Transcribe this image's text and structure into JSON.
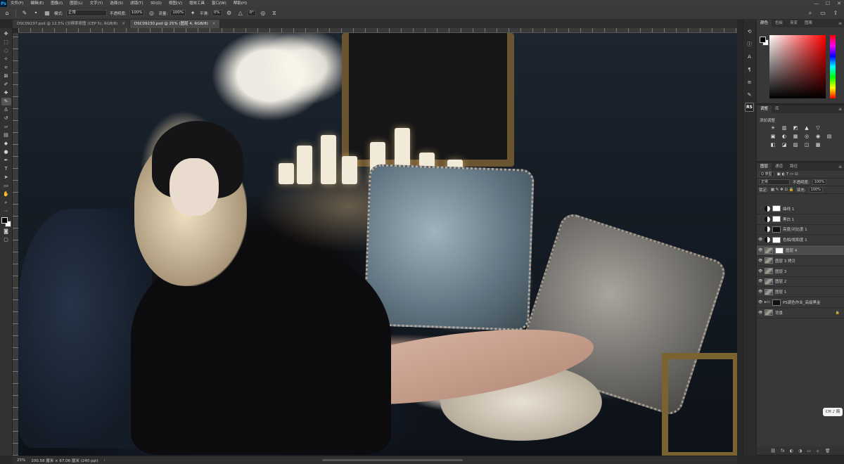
{
  "app": {
    "logo": "Ps"
  },
  "menu": [
    "文件(F)",
    "编辑(E)",
    "图像(I)",
    "图层(L)",
    "文字(Y)",
    "选择(S)",
    "滤镜(T)",
    "3D(D)",
    "视图(V)",
    "增效工具",
    "窗口(W)",
    "帮助(H)"
  ],
  "window_controls": {
    "minimize": "—",
    "maximize": "☐",
    "close": "✕"
  },
  "options": {
    "mode_label": "模式:",
    "mode_value": "正常",
    "opacity_label": "不透明度:",
    "opacity_value": "100%",
    "flow_label": "流量:",
    "flow_value": "100%",
    "smooth_label": "平滑:",
    "smooth_value": "0%",
    "angle_value": "0°"
  },
  "tabs": [
    {
      "label": "DSC09237.psd @ 12.5% (分辨率修图 (CEP 5), RGB/8)",
      "close": "✕"
    },
    {
      "label": "DSC09230.psd @ 25% (图层 4, RGB/8)",
      "close": "✕"
    }
  ],
  "status": {
    "zoom": "25%",
    "doc_size": "100.58 厘米 × 67.06 厘米 (240 ppi)"
  },
  "color_panel": {
    "tabs": [
      "颜色",
      "色板",
      "渐变",
      "图案"
    ]
  },
  "adjustments_panel": {
    "tabs": [
      "调整",
      "库"
    ],
    "title": "添加调整",
    "icons": [
      "☀",
      "▥",
      "◩",
      "▲",
      "▽",
      "",
      "▣",
      "◐",
      "▦",
      "◎",
      "◉",
      "▤",
      "◧",
      "◪",
      "▨",
      "◫",
      "▩",
      ""
    ]
  },
  "layers_panel": {
    "tabs": [
      "图层",
      "通道",
      "路径"
    ],
    "filter_label": "Q 类型",
    "blend_mode": "正常",
    "opacity_label": "不透明度:",
    "opacity_value": "100%",
    "lock_label": "锁定:",
    "fill_label": "填充:",
    "fill_value": "100%",
    "layers": [
      {
        "name": "曲线 1",
        "visible": "",
        "kind": "adj",
        "mask": "white"
      },
      {
        "name": "黑白 1",
        "visible": "",
        "kind": "adj",
        "mask": "white"
      },
      {
        "name": "亮度/对比度 1",
        "visible": "",
        "kind": "adj",
        "mask": "black"
      },
      {
        "name": "色相/饱和度 1",
        "visible": "👁",
        "kind": "adj",
        "mask": "white"
      },
      {
        "name": "图层 4",
        "visible": "👁",
        "kind": "pic",
        "mask": "white",
        "selected": true
      },
      {
        "name": "图层 3 拷贝",
        "visible": "👁",
        "kind": "pic"
      },
      {
        "name": "图层 3",
        "visible": "👁",
        "kind": "pic"
      },
      {
        "name": "图层 2",
        "visible": "👁",
        "kind": "pic"
      },
      {
        "name": "图层 1",
        "visible": "👁",
        "kind": "pic"
      },
      {
        "name": "PS调色作业_高级黑金",
        "visible": "👁",
        "kind": "group",
        "mask": "black"
      },
      {
        "name": "背景",
        "visible": "👁",
        "kind": "pic",
        "lock": "🔒"
      }
    ],
    "footer": [
      "⛓",
      "fx",
      "◐",
      "◑",
      "▭",
      "＋",
      "🗑"
    ]
  },
  "ime": {
    "label": "CH ♪ 简"
  }
}
